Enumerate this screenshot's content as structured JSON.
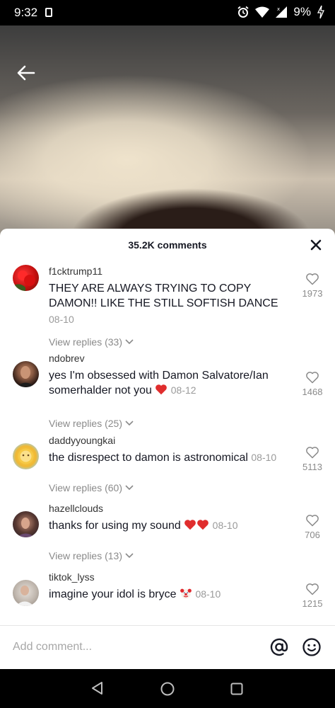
{
  "status_bar": {
    "time": "9:32",
    "battery": "9%"
  },
  "comments_header": {
    "title": "35.2K comments"
  },
  "comments": [
    {
      "username": "f1cktrump11",
      "text": "THEY ARE ALWAYS TRYING TO COPY DAMON!! LIKE THE STILL SOFTISH DANCE",
      "date": "08-10",
      "likes": "1973",
      "replies": "View replies (33)"
    },
    {
      "username": "ndobrev",
      "text": "yes I'm obsessed with Damon Salvatore/Ian somerhalder not you",
      "date": "08-12",
      "likes": "1468",
      "replies": "View replies (25)"
    },
    {
      "username": "daddyyoungkai",
      "text": "the disrespect to damon is astronomical",
      "date": "08-10",
      "likes": "5113",
      "replies": "View replies (60)"
    },
    {
      "username": "hazellclouds",
      "text": "thanks for using my sound",
      "date": "08-10",
      "likes": "706",
      "replies": "View replies (13)"
    },
    {
      "username": "tiktok_lyss",
      "text": "imagine your idol is bryce",
      "date": "08-10",
      "likes": "1215"
    }
  ],
  "input": {
    "placeholder": "Add comment..."
  },
  "colors": {
    "heart": "#e02d2d",
    "text": "#161823",
    "muted": "#8a8a8a"
  }
}
